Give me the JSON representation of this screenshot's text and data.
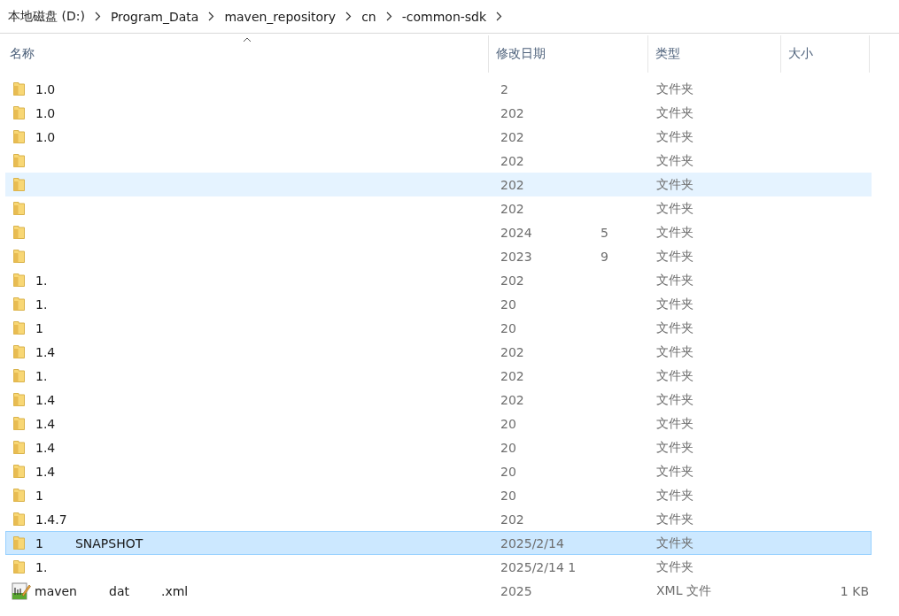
{
  "breadcrumb": [
    "本地磁盘 (D:)",
    "Program_Data",
    "maven_repository",
    "cn",
    "-common-sdk"
  ],
  "columns": [
    "名称",
    "修改日期",
    "类型",
    "大小"
  ],
  "rows": [
    {
      "kind": "folder",
      "name_parts": [
        "1.0"
      ],
      "date": "2",
      "type": "文件夹",
      "selected": false,
      "hovered": false
    },
    {
      "kind": "folder",
      "name_parts": [
        "1.0"
      ],
      "date": "202",
      "type": "文件夹",
      "selected": false,
      "hovered": false
    },
    {
      "kind": "folder",
      "name_parts": [
        "1.0"
      ],
      "date": "202",
      "type": "文件夹",
      "selected": false,
      "hovered": false
    },
    {
      "kind": "folder",
      "date": "202",
      "type": "文件夹",
      "selected": false,
      "hovered": false
    },
    {
      "kind": "folder",
      "date": "202",
      "type": "文件夹",
      "selected": false,
      "hovered": true
    },
    {
      "kind": "folder",
      "date": "202",
      "type": "文件夹",
      "selected": false,
      "hovered": false
    },
    {
      "kind": "folder",
      "date": "2024",
      "date_tail": "5",
      "type": "文件夹",
      "selected": false,
      "hovered": false
    },
    {
      "kind": "folder",
      "date": "2023",
      "date_tail": "9",
      "type": "文件夹",
      "selected": false,
      "hovered": false
    },
    {
      "kind": "folder",
      "name_parts": [
        "1."
      ],
      "date": "202",
      "type": "文件夹",
      "selected": false,
      "hovered": false
    },
    {
      "kind": "folder",
      "name_parts": [
        "1."
      ],
      "date": "20",
      "type": "文件夹",
      "selected": false,
      "hovered": false
    },
    {
      "kind": "folder",
      "name_parts": [
        "1"
      ],
      "date": "20",
      "type": "文件夹",
      "selected": false,
      "hovered": false
    },
    {
      "kind": "folder",
      "name_parts": [
        "1.4"
      ],
      "date": "202",
      "type": "文件夹",
      "selected": false,
      "hovered": false
    },
    {
      "kind": "folder",
      "name_parts": [
        "1."
      ],
      "date": "202",
      "type": "文件夹",
      "selected": false,
      "hovered": false
    },
    {
      "kind": "folder",
      "name_parts": [
        "1.4"
      ],
      "date": "202",
      "type": "文件夹",
      "selected": false,
      "hovered": false
    },
    {
      "kind": "folder",
      "name_parts": [
        "1.4"
      ],
      "date": "20",
      "type": "文件夹",
      "selected": false,
      "hovered": false
    },
    {
      "kind": "folder",
      "name_parts": [
        "1.4"
      ],
      "date": "20",
      "type": "文件夹",
      "selected": false,
      "hovered": false
    },
    {
      "kind": "folder",
      "name_parts": [
        "1.4"
      ],
      "date": "20",
      "type": "文件夹",
      "selected": false,
      "hovered": false
    },
    {
      "kind": "folder",
      "name_parts": [
        "1"
      ],
      "date": "20",
      "type": "文件夹",
      "selected": false,
      "hovered": false
    },
    {
      "kind": "folder",
      "name_parts": [
        "1.4.7"
      ],
      "date": "202",
      "type": "文件夹",
      "selected": false,
      "hovered": false
    },
    {
      "kind": "folder",
      "name_parts": [
        "1",
        "SNAPSHOT"
      ],
      "date": "2025/2/14",
      "type": "文件夹",
      "selected": true,
      "hovered": false
    },
    {
      "kind": "folder",
      "name_parts": [
        "1."
      ],
      "date": "2025/2/14 1",
      "type": "文件夹",
      "selected": false,
      "hovered": false
    },
    {
      "kind": "xml",
      "name_parts": [
        "maven",
        "dat",
        ".xml"
      ],
      "date": "2025",
      "type": "XML 文件",
      "size": "1 KB",
      "selected": false,
      "hovered": false
    }
  ]
}
